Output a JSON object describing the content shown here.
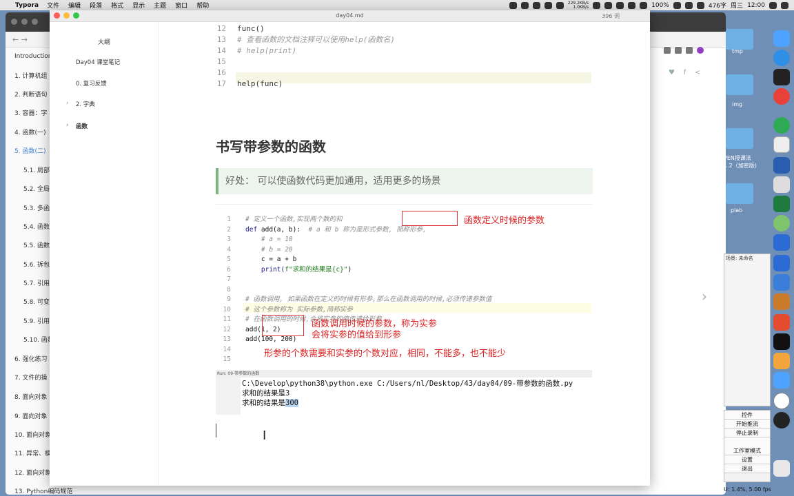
{
  "menubar": {
    "app": "Typora",
    "items": [
      "文件",
      "编辑",
      "段落",
      "格式",
      "显示",
      "主题",
      "窗口",
      "帮助"
    ],
    "net_up": "229.2KB/s",
    "net_down": "1.0KB/s",
    "battery": "100%",
    "chars": "476字",
    "day": "周三",
    "time": "12:00"
  },
  "window": {
    "title": "day04.md",
    "word_count": "396 词"
  },
  "outline": {
    "header": "大纲",
    "items": [
      {
        "label": "Day04 课堂笔记",
        "indent": 0,
        "bold": false,
        "arrow": false
      },
      {
        "label": "0. 复习反馈",
        "indent": 1,
        "bold": false,
        "arrow": false
      },
      {
        "label": "2. 字典",
        "indent": 1,
        "bold": false,
        "arrow": true
      },
      {
        "label": "函数",
        "indent": 1,
        "bold": true,
        "arrow": true
      }
    ]
  },
  "bg_sidebar": {
    "items": [
      "Introduction",
      "1. 计算机组",
      "2. 判断语句",
      "3. 容器：字",
      "4. 函数(一)",
      "5. 函数(二)",
      "5.1. 局部",
      "5.2. 全局",
      "5.3. 多函",
      "5.4. 函数",
      "5.5. 函数",
      "5.6. 拆包",
      "5.7. 引用",
      "5.8. 可变",
      "5.9. 引用",
      "5.10. 函数",
      "6. 强化练习",
      "7. 文件的操",
      "8. 面向对象",
      "9. 面向对象",
      "10. 面向对象",
      "11. 异常、模",
      "12. 面向对象",
      "13. Python编码规范"
    ],
    "active_index": 5
  },
  "code_top": {
    "lines": [
      {
        "num": "12",
        "text": "func()",
        "comment": false
      },
      {
        "num": "13",
        "text": "# 查看函数的文档注释可以使用help(函数名)",
        "comment": true
      },
      {
        "num": "14",
        "text": "# help(print)",
        "comment": true
      },
      {
        "num": "15",
        "text": "",
        "comment": false
      },
      {
        "num": "16",
        "text": "",
        "comment": false
      },
      {
        "num": "17",
        "text": "help(func)",
        "comment": false
      }
    ]
  },
  "heading": "书写带参数的函数",
  "quote": "好处： 可以使函数代码更加通用，适用更多的场景",
  "ide": {
    "lines": [
      {
        "num": "1",
        "segs": [
          {
            "t": "# 定义一个函数,实现两个数的和",
            "c": "com"
          }
        ]
      },
      {
        "num": "2",
        "segs": [
          {
            "t": "def ",
            "c": "kw"
          },
          {
            "t": "add(a, b):  ",
            "c": "plain"
          },
          {
            "t": "# a 和 b 称为是形式参数, 简称形参,",
            "c": "com"
          }
        ]
      },
      {
        "num": "3",
        "segs": [
          {
            "t": "    # a = 10",
            "c": "com"
          }
        ]
      },
      {
        "num": "4",
        "segs": [
          {
            "t": "    # b = 20",
            "c": "com"
          }
        ]
      },
      {
        "num": "5",
        "segs": [
          {
            "t": "    c = a + b",
            "c": "plain"
          }
        ]
      },
      {
        "num": "6",
        "segs": [
          {
            "t": "    print(",
            "c": "kw"
          },
          {
            "t": "f\"求和的结果是{c}\"",
            "c": "str"
          },
          {
            "t": ")",
            "c": "plain"
          }
        ]
      },
      {
        "num": "7",
        "segs": []
      },
      {
        "num": "8",
        "segs": []
      },
      {
        "num": "9",
        "segs": [
          {
            "t": "# 函数调用, 如果函数在定义的时候有形参,那么在函数调用的时候,必须传递参数值",
            "c": "com"
          }
        ]
      },
      {
        "num": "10",
        "segs": [
          {
            "t": "# 这个参数称为 实际参数,简称实参",
            "c": "com"
          }
        ]
      },
      {
        "num": "11",
        "segs": [
          {
            "t": "# 在函数调用的时候,会将实参的值传递给形参",
            "c": "com"
          }
        ]
      },
      {
        "num": "12",
        "segs": [
          {
            "t": "add(1, 2)",
            "c": "plain"
          }
        ]
      },
      {
        "num": "13",
        "segs": [
          {
            "t": "add(100, 200)",
            "c": "plain"
          }
        ]
      },
      {
        "num": "14",
        "segs": []
      },
      {
        "num": "15",
        "segs": []
      }
    ],
    "annotations": {
      "formal": "函数定义时候的参数",
      "actual1": "函数调用时候的参数，称为实参",
      "actual2": "会将实参的值给到形参",
      "count": "形参的个数需要和实参的个数对应，相同，不能多，也不能少"
    },
    "run_tab": "Run:   09-带参数的函数",
    "run_lines": {
      "cmd": "C:\\Develop\\python38\\python.exe C:/Users/nl/Desktop/43/day04/09-带参数的函数.py",
      "out1": "求和的结果是3",
      "out2_prefix": "求和的结果是",
      "out2_sel": "300"
    }
  },
  "desktop": {
    "folders": [
      "tmp",
      "img",
      "PEN授课法",
      "1.2（加密版)",
      "plab"
    ],
    "bg_panel_title": "场景: 未命名"
  },
  "obs": {
    "title": "控件",
    "buttons": [
      "开始推流",
      "停止录制",
      "工作室模式",
      "设置",
      "退出"
    ],
    "status": "U: 1.4%, 5.00 fps"
  },
  "colors": {
    "accent_red": "#d22222",
    "link_blue": "#3d7cd5",
    "quote_border": "#7fb27f"
  }
}
